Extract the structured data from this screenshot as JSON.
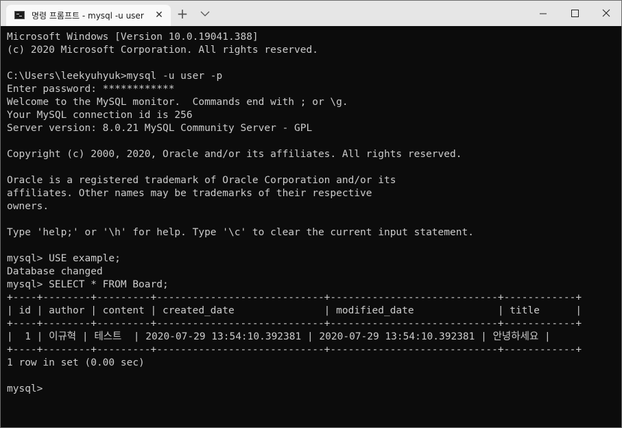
{
  "window": {
    "tab_title": "명령 프롬프트 - mysql  -u user",
    "tab_close_glyph": "✕",
    "new_tab_glyph": "+",
    "tab_icon": "terminal-icon",
    "dropdown_icon": "chevron-down-icon",
    "minimize_icon": "minimize-icon",
    "maximize_icon": "maximize-icon",
    "close_icon": "close-icon"
  },
  "terminal": {
    "lines": [
      "Microsoft Windows [Version 10.0.19041.388]",
      "(c) 2020 Microsoft Corporation. All rights reserved.",
      "",
      "C:\\Users\\leekyuhyuk>mysql -u user -p",
      "Enter password: ************",
      "Welcome to the MySQL monitor.  Commands end with ; or \\g.",
      "Your MySQL connection id is 256",
      "Server version: 8.0.21 MySQL Community Server - GPL",
      "",
      "Copyright (c) 2000, 2020, Oracle and/or its affiliates. All rights reserved.",
      "",
      "Oracle is a registered trademark of Oracle Corporation and/or its",
      "affiliates. Other names may be trademarks of their respective",
      "owners.",
      "",
      "Type 'help;' or '\\h' for help. Type '\\c' to clear the current input statement.",
      "",
      "mysql> USE example;",
      "Database changed",
      "mysql> SELECT * FROM Board;",
      "+----+--------+---------+----------------------------+----------------------------+------------+",
      "| id | author | content | created_date               | modified_date              | title      |",
      "+----+--------+---------+----------------------------+----------------------------+------------+",
      "|  1 | 이규혁 | 테스트  | 2020-07-29 13:54:10.392381 | 2020-07-29 13:54:10.392381 | 안녕하세요 |",
      "+----+--------+---------+----------------------------+----------------------------+------------+",
      "1 row in set (0.00 sec)",
      "",
      "mysql>"
    ]
  }
}
